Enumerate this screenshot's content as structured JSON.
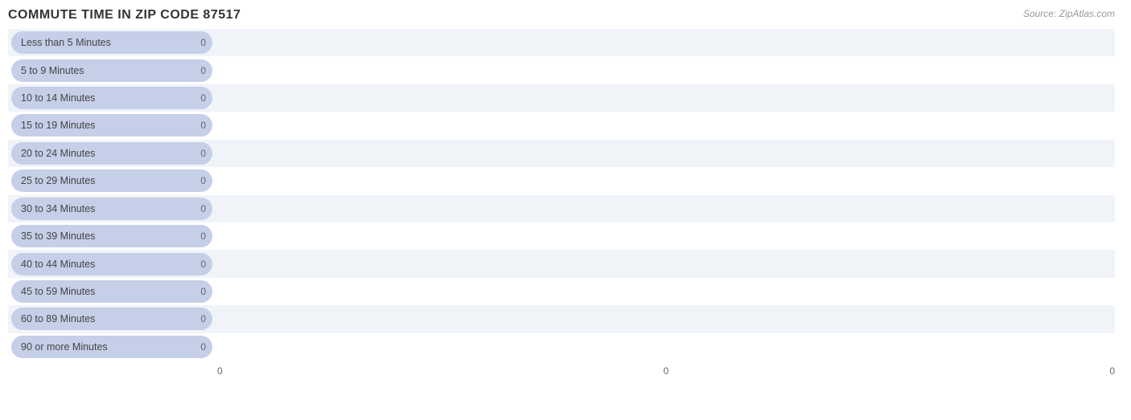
{
  "title": "COMMUTE TIME IN ZIP CODE 87517",
  "source": "Source: ZipAtlas.com",
  "bars": [
    {
      "label": "Less than 5 Minutes",
      "value": 0
    },
    {
      "label": "5 to 9 Minutes",
      "value": 0
    },
    {
      "label": "10 to 14 Minutes",
      "value": 0
    },
    {
      "label": "15 to 19 Minutes",
      "value": 0
    },
    {
      "label": "20 to 24 Minutes",
      "value": 0
    },
    {
      "label": "25 to 29 Minutes",
      "value": 0
    },
    {
      "label": "30 to 34 Minutes",
      "value": 0
    },
    {
      "label": "35 to 39 Minutes",
      "value": 0
    },
    {
      "label": "40 to 44 Minutes",
      "value": 0
    },
    {
      "label": "45 to 59 Minutes",
      "value": 0
    },
    {
      "label": "60 to 89 Minutes",
      "value": 0
    },
    {
      "label": "90 or more Minutes",
      "value": 0
    }
  ],
  "x_axis_labels": [
    "0",
    "0",
    "0"
  ],
  "colors": {
    "pill_bg": "#c5cfe8",
    "bar_fill": "#a0b0d8",
    "odd_row": "#f0f4f8",
    "even_row": "#ffffff"
  }
}
